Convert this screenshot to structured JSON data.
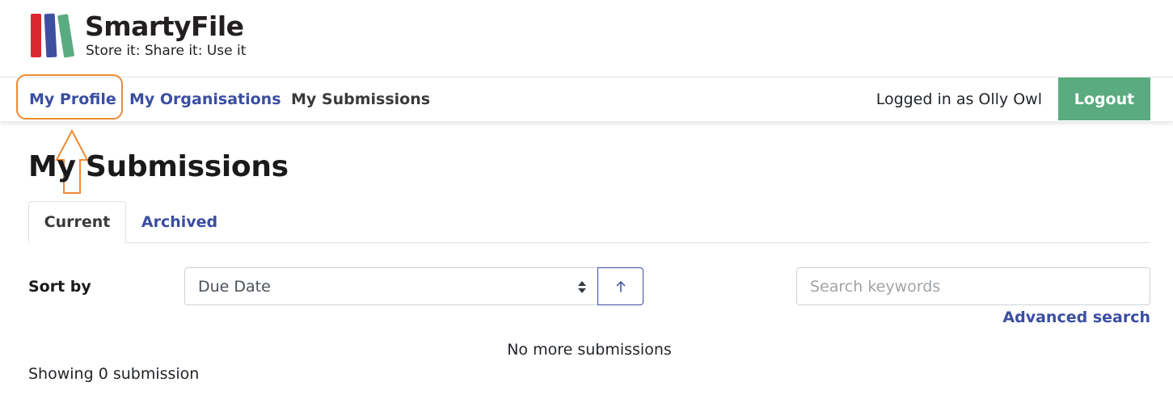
{
  "brand": {
    "name": "SmartyFile",
    "tagline": "Store it: Share it: Use it",
    "colors": {
      "red": "#d9282f",
      "blue": "#3c4fa0",
      "green": "#5aab80"
    }
  },
  "nav": {
    "items": [
      {
        "label": "My Profile"
      },
      {
        "label": "My Organisations"
      },
      {
        "label": "My Submissions"
      }
    ],
    "logged_in_text": "Logged in as Olly Owl",
    "logout_label": "Logout"
  },
  "page": {
    "title": "My Submissions",
    "tabs": [
      {
        "label": "Current",
        "active": true
      },
      {
        "label": "Archived",
        "active": false
      }
    ]
  },
  "controls": {
    "sort_label": "Sort by",
    "sort_value": "Due Date",
    "sort_direction_icon": "arrow-up-icon",
    "search_placeholder": "Search keywords",
    "search_value": "",
    "advanced_search_label": "Advanced search"
  },
  "results": {
    "no_more_text": "No more submissions",
    "count_text": "Showing 0 submission"
  },
  "annotation": {
    "highlight_color": "#ef8a34",
    "icon": "arrow-up-outline-icon"
  }
}
